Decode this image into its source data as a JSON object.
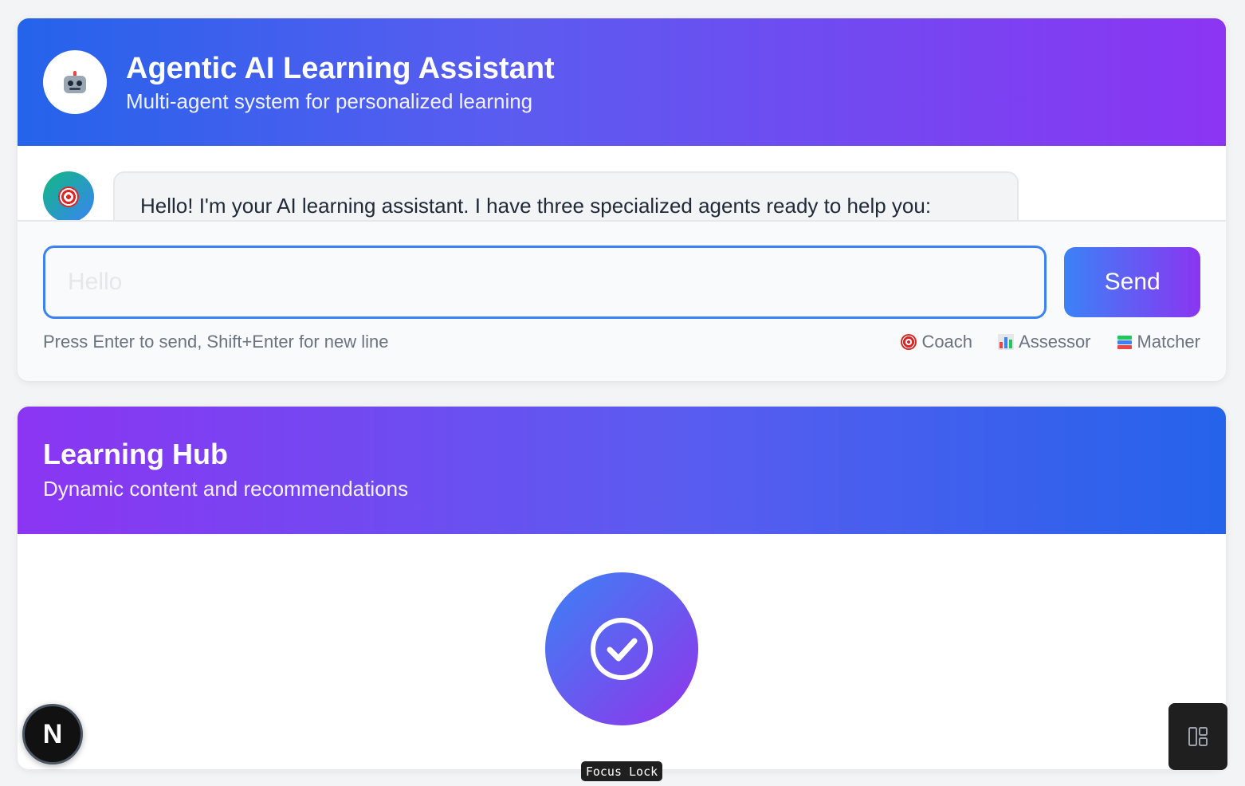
{
  "chat": {
    "title": "Agentic AI Learning Assistant",
    "subtitle": "Multi-agent system for personalized learning",
    "first_message": "Hello! I'm your AI learning assistant. I have three specialized agents ready to help you:",
    "input": {
      "value": "",
      "placeholder": "Hello"
    },
    "send_label": "Send",
    "hint": "Press Enter to send, Shift+Enter for new line",
    "agents": [
      {
        "label": "Coach",
        "icon": "target-icon"
      },
      {
        "label": "Assessor",
        "icon": "bar-chart-icon"
      },
      {
        "label": "Matcher",
        "icon": "books-icon"
      }
    ]
  },
  "hub": {
    "title": "Learning Hub",
    "subtitle": "Dynamic content and recommendations"
  },
  "overlay": {
    "next_badge": "N",
    "focus_lock": "Focus Lock"
  },
  "colors": {
    "primary_blue": "#2563eb",
    "primary_purple": "#8b35f2",
    "input_border": "#3b82f6"
  }
}
